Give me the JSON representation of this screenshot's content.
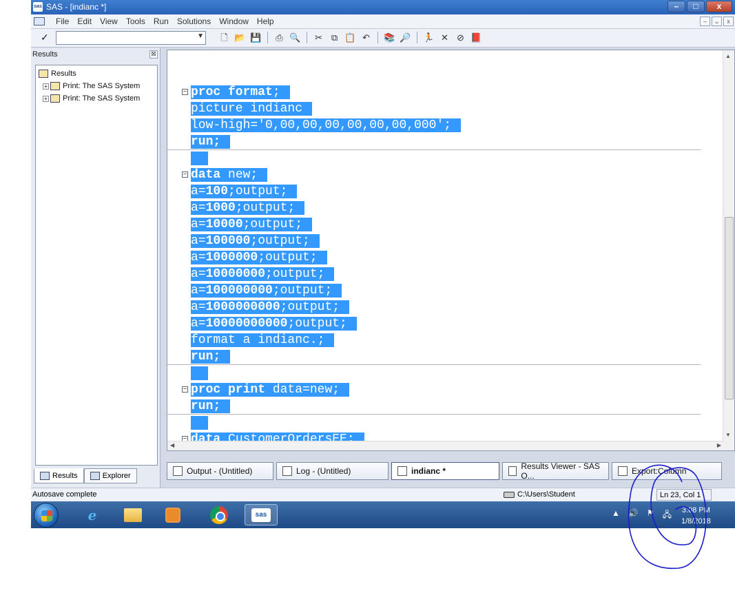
{
  "window": {
    "app_icon_text": "sas",
    "title": "SAS - [indianc *]",
    "minimize": "–",
    "maximize": "□",
    "close": "x"
  },
  "menu": {
    "items": [
      "File",
      "Edit",
      "View",
      "Tools",
      "Run",
      "Solutions",
      "Window",
      "Help"
    ],
    "mdi_minimize": "–",
    "mdi_restore": "ᴗ",
    "mdi_close": "x"
  },
  "toolbar": {
    "command_value": "",
    "check_glyph": "✓",
    "dropdown_glyph": "▼"
  },
  "results": {
    "header": "Results",
    "close_glyph": "☒",
    "tree": [
      {
        "label": "Results",
        "level": 0
      },
      {
        "label": "Print:  The SAS System",
        "level": 1
      },
      {
        "label": "Print:  The SAS System",
        "level": 1
      }
    ],
    "tabs": [
      "Results",
      "Explorer"
    ]
  },
  "editor": {
    "lines": [
      {
        "text": "proc format;",
        "kw": "proc format",
        "fold": true
      },
      {
        "text": "picture indianc",
        "kw": "",
        "fold": false
      },
      {
        "text": "low-high='0,00,00,00,00,00,00,000';",
        "kw": "",
        "fold": false
      },
      {
        "text": "run;",
        "kw": "run;",
        "fold": false
      },
      {
        "text": "",
        "kw": "",
        "fold": false
      },
      {
        "text": "data new;",
        "kw": "data",
        "fold": true
      },
      {
        "text": "a=100;output;",
        "kw": "100",
        "fold": false
      },
      {
        "text": "a=1000;output;",
        "kw": "1000",
        "fold": false
      },
      {
        "text": "a=10000;output;",
        "kw": "10000",
        "fold": false
      },
      {
        "text": "a=100000;output;",
        "kw": "100000",
        "fold": false
      },
      {
        "text": "a=1000000;output;",
        "kw": "1000000",
        "fold": false
      },
      {
        "text": "a=10000000;output;",
        "kw": "10000000",
        "fold": false
      },
      {
        "text": "a=100000000;output;",
        "kw": "100000000",
        "fold": false
      },
      {
        "text": "a=1000000000;output;",
        "kw": "1000000000",
        "fold": false
      },
      {
        "text": "a=10000000000;output;",
        "kw": "10000000000",
        "fold": false
      },
      {
        "text": "format a indianc.;",
        "kw": "",
        "fold": false
      },
      {
        "text": "run;",
        "kw": "run;",
        "fold": false
      },
      {
        "text": "",
        "kw": "",
        "fold": false
      },
      {
        "text": "proc print data=new;",
        "kw": "proc print",
        "fold": true
      },
      {
        "text": "run;",
        "kw": "run;",
        "fold": false
      },
      {
        "text": "",
        "kw": "",
        "fold": false
      },
      {
        "text": "data CustomerOrdersEE;",
        "kw": "data",
        "fold": true
      }
    ]
  },
  "window_tabs": [
    {
      "label": "Output - (Untitled)",
      "active": false
    },
    {
      "label": "Log - (Untitled)",
      "active": false
    },
    {
      "label": "indianc *",
      "active": true
    },
    {
      "label": "Results Viewer - SAS O...",
      "active": false
    },
    {
      "label": "Export:Column",
      "active": false
    }
  ],
  "status": {
    "message": "Autosave complete",
    "path": "C:\\Users\\Student",
    "position": "Ln 23, Col 1"
  },
  "taskbar": {
    "sas_label": "sas",
    "ie_glyph": "e",
    "tray_up": "▲",
    "tray_volume": "🔊",
    "tray_flag": "⚑",
    "time": "3:08 PM",
    "date": "1/8/2018"
  },
  "colors": {
    "selection": "#3399ff",
    "annotation_ink": "#1a1acc"
  }
}
